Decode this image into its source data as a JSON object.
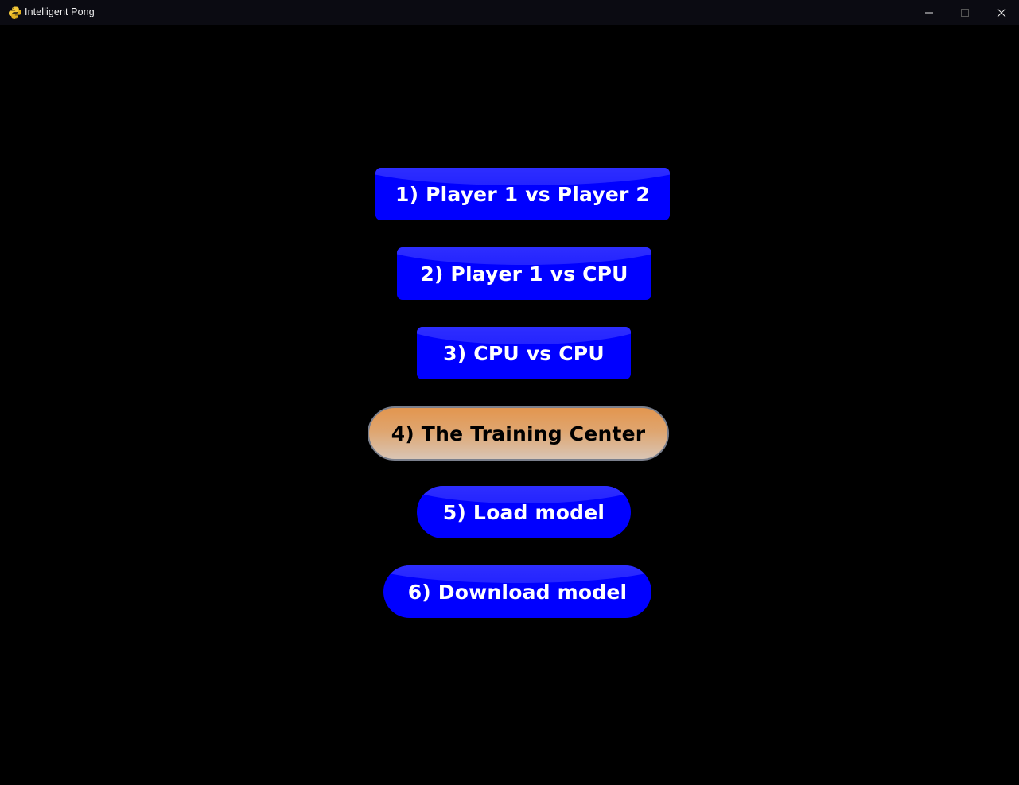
{
  "window": {
    "title": "Intelligent Pong",
    "app_icon": "python-icon",
    "controls": [
      "minimize-icon",
      "maximize-icon",
      "close-icon"
    ]
  },
  "menu": {
    "items": [
      {
        "label": "1) Player 1 vs Player 2",
        "shape": "rounded-rect",
        "state": "normal"
      },
      {
        "label": "2) Player 1 vs CPU",
        "shape": "rounded-rect",
        "state": "normal"
      },
      {
        "label": "3) CPU vs CPU",
        "shape": "rounded-rect",
        "state": "normal"
      },
      {
        "label": "4) The Training Center",
        "shape": "pill",
        "state": "hover"
      },
      {
        "label": "5) Load model",
        "shape": "pill",
        "state": "normal"
      },
      {
        "label": "6) Download model",
        "shape": "pill",
        "state": "normal"
      }
    ]
  },
  "colors": {
    "background": "#000000",
    "button_blue": "#0000ff",
    "button_hover": "#e3964f",
    "text_light": "#ffffff",
    "text_dark": "#000000"
  }
}
